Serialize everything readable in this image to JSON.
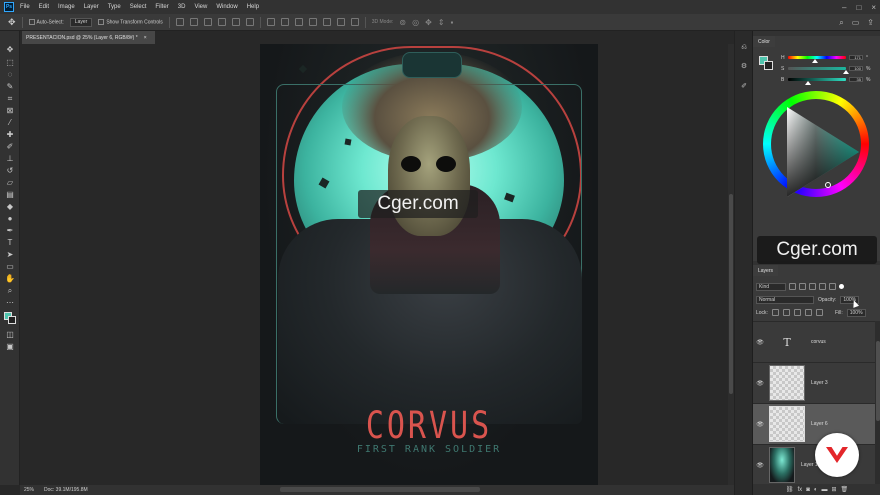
{
  "menu": {
    "logo": "Ps",
    "items": [
      "File",
      "Edit",
      "Image",
      "Layer",
      "Type",
      "Select",
      "Filter",
      "3D",
      "View",
      "Window",
      "Help"
    ]
  },
  "options": {
    "auto_select_label": "Auto-Select:",
    "auto_select_value": "Layer",
    "show_transform_label": "Show Transform Controls",
    "mode_3d_label": "3D Mode:"
  },
  "document": {
    "tab_title": "PRESENTACION.psd @ 25% (Layer 6, RGB/8#) *",
    "tab_close": "×"
  },
  "artwork": {
    "title": "CORVUS",
    "subtitle": "FIRST RANK SOLDIER"
  },
  "watermark": "Cger.com",
  "status": {
    "zoom": "25%",
    "doc_info": "Doc: 39.1M/195.8M"
  },
  "color_panel": {
    "tab": "Color",
    "sliders": [
      {
        "label": "H",
        "value": "171",
        "unit": "°",
        "position": 0.47
      },
      {
        "label": "S",
        "value": "100",
        "unit": "%",
        "position": 1.0
      },
      {
        "label": "B",
        "value": "35",
        "unit": "%",
        "position": 0.35
      }
    ],
    "foreground": "#4fc4ad",
    "background": "#222222"
  },
  "layers_panel": {
    "tab": "Layers",
    "filter_kind": "Kind",
    "blend_mode": "Normal",
    "opacity_label": "Opacity:",
    "opacity_value": "100%",
    "lock_label": "Lock:",
    "fill_label": "Fill:",
    "fill_value": "100%",
    "layers": [
      {
        "name": "corvus",
        "kind": "type",
        "thumb_glyph": "T"
      },
      {
        "name": "Layer 3",
        "kind": "transparent"
      },
      {
        "name": "Layer 6",
        "kind": "transparent",
        "selected": true
      },
      {
        "name": "Layer 1",
        "kind": "artwork"
      }
    ],
    "bottom_icons": [
      "link-icon",
      "fx-icon",
      "mask-icon",
      "adjustment-icon",
      "group-icon",
      "new-layer-icon",
      "delete-icon"
    ]
  },
  "icons": {
    "eye": "👁",
    "fx": "fx"
  }
}
